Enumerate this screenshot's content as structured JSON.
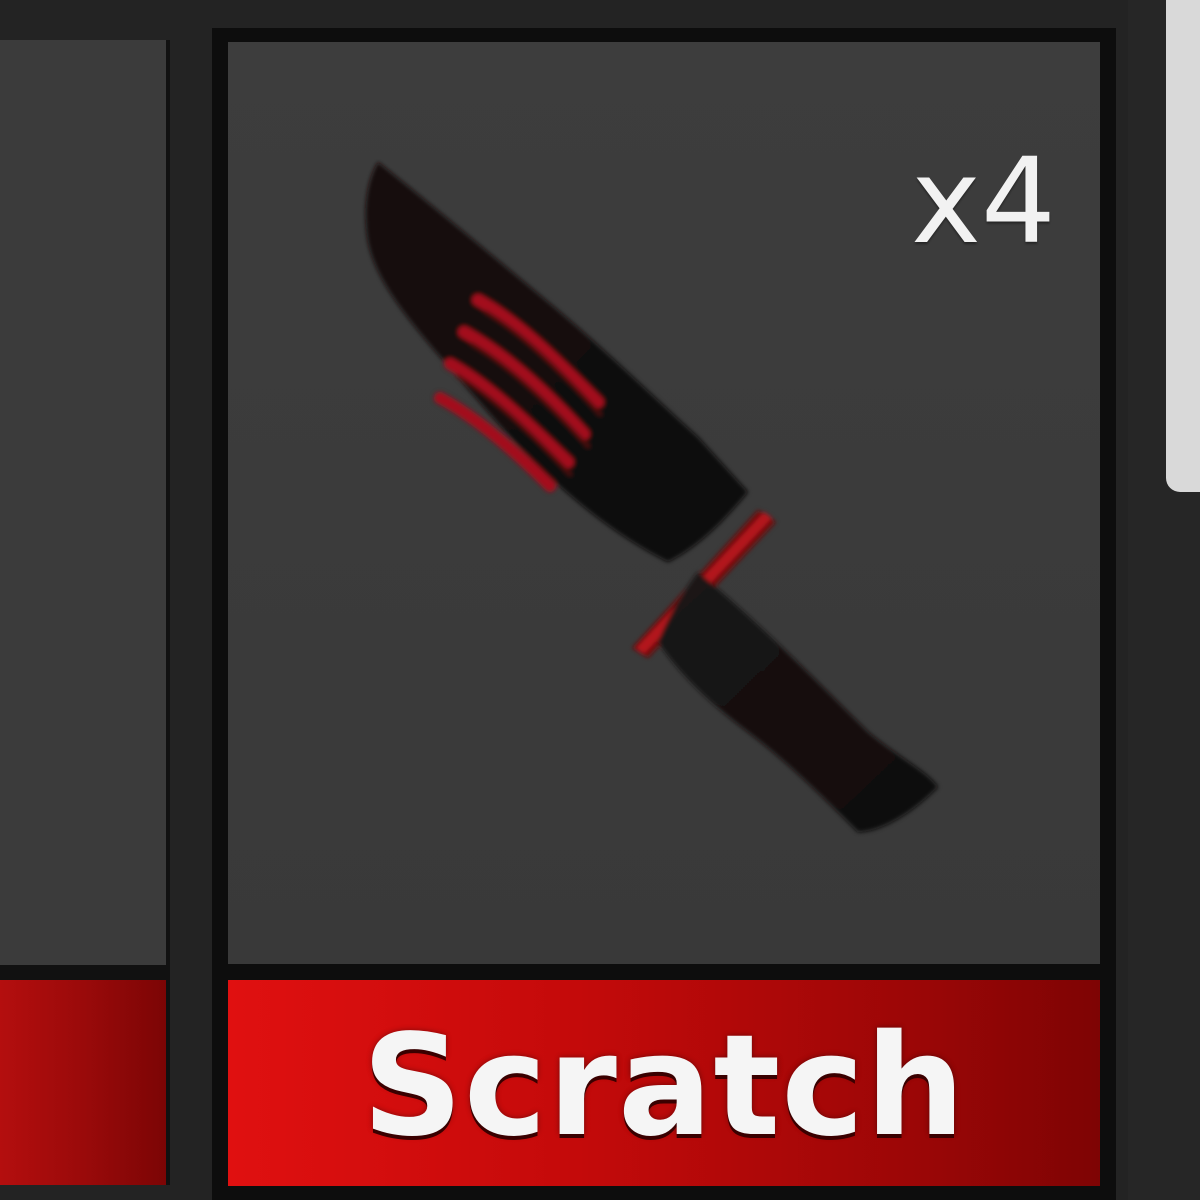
{
  "inventory": {
    "slots": [
      {
        "name": "",
        "quantity": "",
        "rarity_color": "#c01010"
      },
      {
        "name": "Scratch",
        "quantity": "x4",
        "item_icon": "knife-icon",
        "rarity_color": "#e01010"
      }
    ]
  },
  "scrollbar": {
    "color": "#d9d9d9"
  }
}
